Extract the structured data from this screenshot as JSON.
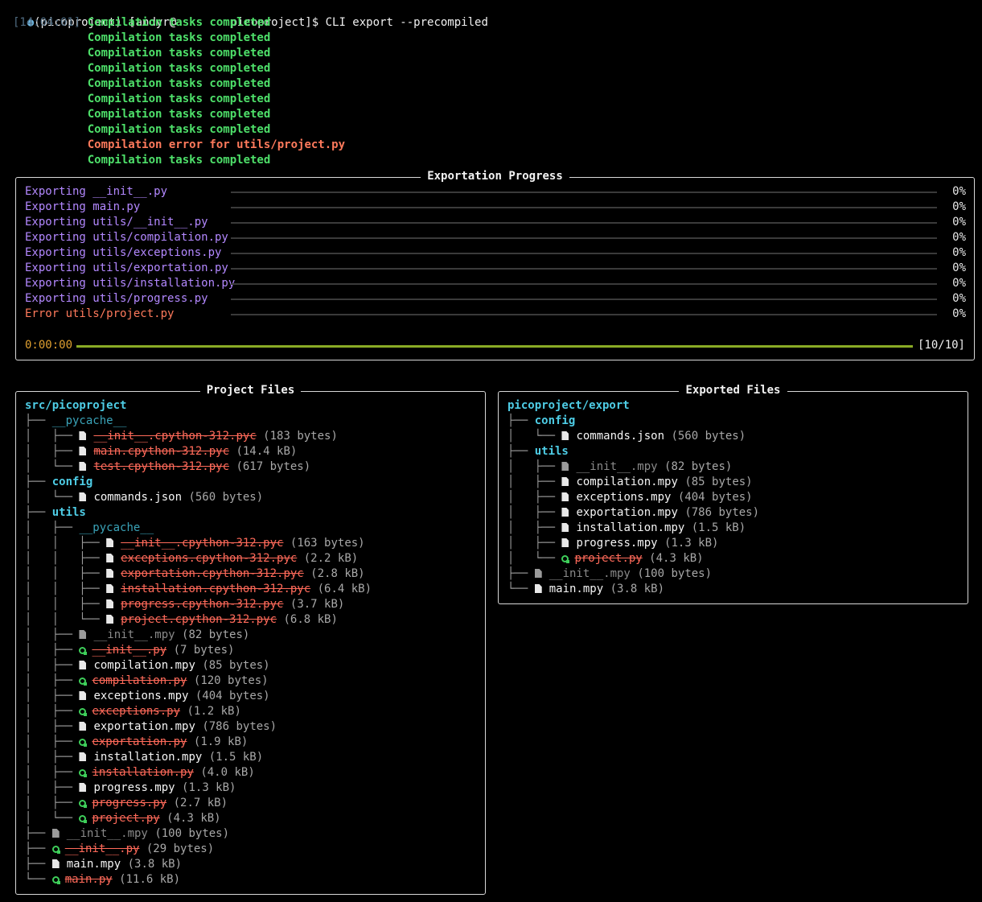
{
  "prompt": {
    "dot": "●",
    "text": "(picoproject) [andyr@        picoproject]$ CLI export --precompiled"
  },
  "log": {
    "timestamp": "[14:04:01]",
    "lines": [
      {
        "text": "Compilation tasks completed",
        "status": "ok"
      },
      {
        "text": "Compilation tasks completed",
        "status": "ok"
      },
      {
        "text": "Compilation tasks completed",
        "status": "ok"
      },
      {
        "text": "Compilation tasks completed",
        "status": "ok"
      },
      {
        "text": "Compilation tasks completed",
        "status": "ok"
      },
      {
        "text": "Compilation tasks completed",
        "status": "ok"
      },
      {
        "text": "Compilation tasks completed",
        "status": "ok"
      },
      {
        "text": "Compilation tasks completed",
        "status": "ok"
      },
      {
        "text": "Compilation error for utils/project.py",
        "status": "error"
      },
      {
        "text": "Compilation tasks completed",
        "status": "ok"
      }
    ]
  },
  "progress": {
    "title": "Exportation Progress",
    "tasks": [
      {
        "label": "Exporting __init__.py",
        "percent": "0%",
        "status": "ok"
      },
      {
        "label": "Exporting main.py",
        "percent": "0%",
        "status": "ok"
      },
      {
        "label": "Exporting utils/__init__.py",
        "percent": "0%",
        "status": "ok"
      },
      {
        "label": "Exporting utils/compilation.py",
        "percent": "0%",
        "status": "ok"
      },
      {
        "label": "Exporting utils/exceptions.py",
        "percent": "0%",
        "status": "ok"
      },
      {
        "label": "Exporting utils/exportation.py",
        "percent": "0%",
        "status": "ok"
      },
      {
        "label": "Exporting utils/installation.py",
        "percent": "0%",
        "status": "ok"
      },
      {
        "label": "Exporting utils/progress.py",
        "percent": "0%",
        "status": "ok"
      },
      {
        "label": "Error utils/project.py",
        "percent": "0%",
        "status": "error"
      }
    ],
    "elapsed": "0:00:00",
    "count": "[10/10]",
    "overall_fraction": 1.0,
    "colors": {
      "task": "#b388ff",
      "error": "#ff7a5c",
      "overall_bar": "#8aaa25",
      "elapsed": "#e0a030"
    }
  },
  "project_files": {
    "title": "Project Files",
    "root": "src/picoproject",
    "rows": [
      {
        "depth": 1,
        "guide": "├── ",
        "kind": "dir",
        "name": "__pycache__",
        "style": "dim"
      },
      {
        "depth": 2,
        "guide": "├── ",
        "kind": "file",
        "name": "__init__.cpython-312.pyc",
        "style": "del",
        "size": "(183 bytes)"
      },
      {
        "depth": 2,
        "guide": "├── ",
        "kind": "file",
        "name": "main.cpython-312.pyc",
        "style": "del",
        "size": "(14.4 kB)"
      },
      {
        "depth": 2,
        "guide": "└── ",
        "kind": "file",
        "name": "test.cpython-312.pyc",
        "style": "del",
        "size": "(617 bytes)"
      },
      {
        "depth": 1,
        "guide": "├── ",
        "kind": "dir",
        "name": "config",
        "style": ""
      },
      {
        "depth": 2,
        "guide": "└── ",
        "kind": "file",
        "name": "commands.json",
        "style": "",
        "size": "(560 bytes)"
      },
      {
        "depth": 1,
        "guide": "├── ",
        "kind": "dir",
        "name": "utils",
        "style": ""
      },
      {
        "depth": 2,
        "guide": "├── ",
        "kind": "dir",
        "name": "__pycache__",
        "style": "dim"
      },
      {
        "depth": 3,
        "guide": "├── ",
        "kind": "file",
        "name": "__init__.cpython-312.pyc",
        "style": "del",
        "size": "(163 bytes)"
      },
      {
        "depth": 3,
        "guide": "├── ",
        "kind": "file",
        "name": "exceptions.cpython-312.pyc",
        "style": "del",
        "size": "(2.2 kB)"
      },
      {
        "depth": 3,
        "guide": "├── ",
        "kind": "file",
        "name": "exportation.cpython-312.pyc",
        "style": "del",
        "size": "(2.8 kB)"
      },
      {
        "depth": 3,
        "guide": "├── ",
        "kind": "file",
        "name": "installation.cpython-312.pyc",
        "style": "del",
        "size": "(6.4 kB)"
      },
      {
        "depth": 3,
        "guide": "├── ",
        "kind": "file",
        "name": "progress.cpython-312.pyc",
        "style": "del",
        "size": "(3.7 kB)"
      },
      {
        "depth": 3,
        "guide": "└── ",
        "kind": "file",
        "name": "project.cpython-312.pyc",
        "style": "del",
        "size": "(6.8 kB)"
      },
      {
        "depth": 2,
        "guide": "├── ",
        "kind": "file",
        "name": "__init__.mpy",
        "style": "dim",
        "size": "(82 bytes)"
      },
      {
        "depth": 2,
        "guide": "├── ",
        "kind": "py",
        "name": "__init__.py",
        "style": "del",
        "size": "(7 bytes)"
      },
      {
        "depth": 2,
        "guide": "├── ",
        "kind": "file",
        "name": "compilation.mpy",
        "style": "",
        "size": "(85 bytes)"
      },
      {
        "depth": 2,
        "guide": "├── ",
        "kind": "py",
        "name": "compilation.py",
        "style": "del",
        "size": "(120 bytes)"
      },
      {
        "depth": 2,
        "guide": "├── ",
        "kind": "file",
        "name": "exceptions.mpy",
        "style": "",
        "size": "(404 bytes)"
      },
      {
        "depth": 2,
        "guide": "├── ",
        "kind": "py",
        "name": "exceptions.py",
        "style": "del",
        "size": "(1.2 kB)"
      },
      {
        "depth": 2,
        "guide": "├── ",
        "kind": "file",
        "name": "exportation.mpy",
        "style": "",
        "size": "(786 bytes)"
      },
      {
        "depth": 2,
        "guide": "├── ",
        "kind": "py",
        "name": "exportation.py",
        "style": "del",
        "size": "(1.9 kB)"
      },
      {
        "depth": 2,
        "guide": "├── ",
        "kind": "file",
        "name": "installation.mpy",
        "style": "",
        "size": "(1.5 kB)"
      },
      {
        "depth": 2,
        "guide": "├── ",
        "kind": "py",
        "name": "installation.py",
        "style": "del",
        "size": "(4.0 kB)"
      },
      {
        "depth": 2,
        "guide": "├── ",
        "kind": "file",
        "name": "progress.mpy",
        "style": "",
        "size": "(1.3 kB)"
      },
      {
        "depth": 2,
        "guide": "├── ",
        "kind": "py",
        "name": "progress.py",
        "style": "del",
        "size": "(2.7 kB)"
      },
      {
        "depth": 2,
        "guide": "└── ",
        "kind": "py",
        "name": "project.py",
        "style": "del",
        "size": "(4.3 kB)"
      },
      {
        "depth": 1,
        "guide": "├── ",
        "kind": "file",
        "name": "__init__.mpy",
        "style": "dim",
        "size": "(100 bytes)"
      },
      {
        "depth": 1,
        "guide": "├── ",
        "kind": "py",
        "name": "__init__.py",
        "style": "del",
        "size": "(29 bytes)"
      },
      {
        "depth": 1,
        "guide": "├── ",
        "kind": "file",
        "name": "main.mpy",
        "style": "",
        "size": "(3.8 kB)"
      },
      {
        "depth": 1,
        "guide": "└── ",
        "kind": "py",
        "name": "main.py",
        "style": "del",
        "size": "(11.6 kB)"
      }
    ]
  },
  "exported_files": {
    "title": "Exported Files",
    "root": "picoproject/export",
    "rows": [
      {
        "depth": 1,
        "guide": "├── ",
        "kind": "dir",
        "name": "config",
        "style": ""
      },
      {
        "depth": 2,
        "guide": "└── ",
        "kind": "file",
        "name": "commands.json",
        "style": "",
        "size": "(560 bytes)"
      },
      {
        "depth": 1,
        "guide": "├── ",
        "kind": "dir",
        "name": "utils",
        "style": ""
      },
      {
        "depth": 2,
        "guide": "├── ",
        "kind": "file",
        "name": "__init__.mpy",
        "style": "dim",
        "size": "(82 bytes)"
      },
      {
        "depth": 2,
        "guide": "├── ",
        "kind": "file",
        "name": "compilation.mpy",
        "style": "",
        "size": "(85 bytes)"
      },
      {
        "depth": 2,
        "guide": "├── ",
        "kind": "file",
        "name": "exceptions.mpy",
        "style": "",
        "size": "(404 bytes)"
      },
      {
        "depth": 2,
        "guide": "├── ",
        "kind": "file",
        "name": "exportation.mpy",
        "style": "",
        "size": "(786 bytes)"
      },
      {
        "depth": 2,
        "guide": "├── ",
        "kind": "file",
        "name": "installation.mpy",
        "style": "",
        "size": "(1.5 kB)"
      },
      {
        "depth": 2,
        "guide": "├── ",
        "kind": "file",
        "name": "progress.mpy",
        "style": "",
        "size": "(1.3 kB)"
      },
      {
        "depth": 2,
        "guide": "└── ",
        "kind": "py",
        "name": "project.py",
        "style": "del",
        "size": "(4.3 kB)"
      },
      {
        "depth": 1,
        "guide": "├── ",
        "kind": "file",
        "name": "__init__.mpy",
        "style": "dim",
        "size": "(100 bytes)"
      },
      {
        "depth": 1,
        "guide": "└── ",
        "kind": "file",
        "name": "main.mpy",
        "style": "",
        "size": "(3.8 kB)"
      }
    ]
  }
}
